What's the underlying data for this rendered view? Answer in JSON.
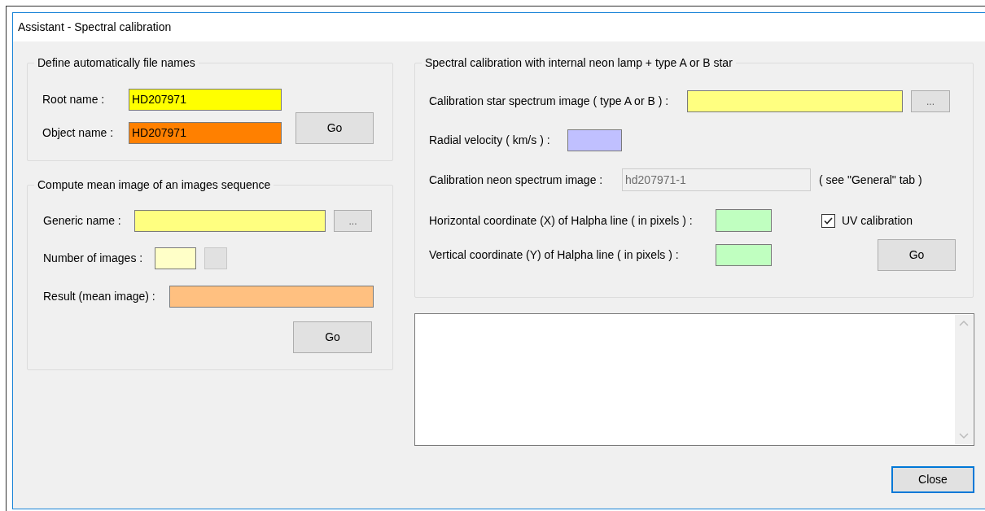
{
  "window": {
    "title": "Assistant - Spectral calibration"
  },
  "file_names": {
    "title": "Define automatically file names",
    "fields": [
      {
        "label": "Root name :",
        "value": "HD207971",
        "color": "#ffff00"
      },
      {
        "label": "Object name :",
        "value": "HD207971",
        "color": "#ff8000"
      }
    ],
    "go_button": "Go"
  },
  "mean_image": {
    "title": "Compute mean image of an images sequence",
    "generic_name": {
      "label": "Generic name :",
      "color": "#ffff80",
      "browse_button": "..."
    },
    "number_of_images": {
      "label": "Number of images :",
      "color": "#ffffc8"
    },
    "result": {
      "label": "Result (mean image) :",
      "color": "#ffc080"
    },
    "go_button": "Go"
  },
  "calibration": {
    "title": "Spectral calibration with internal neon lamp + type A or B star",
    "star_image": {
      "label": "Calibration star spectrum image ( type A or B ) :",
      "color": "#ffff80",
      "browse_button": "..."
    },
    "radial_velocity": {
      "label": "Radial velocity ( km/s ) :",
      "color": "#c0c0ff"
    },
    "neon_image": {
      "label": "Calibration neon spectrum image :",
      "value": "hd207971-1",
      "disabled": true,
      "note": "( see \"General\" tab )"
    },
    "x_coordinate": {
      "label": "Horizontal coordinate (X) of Halpha line ( in pixels ) :",
      "color": "#c0ffc0"
    },
    "uv_calibration": {
      "label": "UV calibration",
      "checked": true
    },
    "y_coordinate": {
      "label": "Vertical coordinate (Y) of Halpha line ( in pixels ) :",
      "color": "#c0ffc0"
    },
    "go_button": "Go"
  },
  "close_button": "Close"
}
